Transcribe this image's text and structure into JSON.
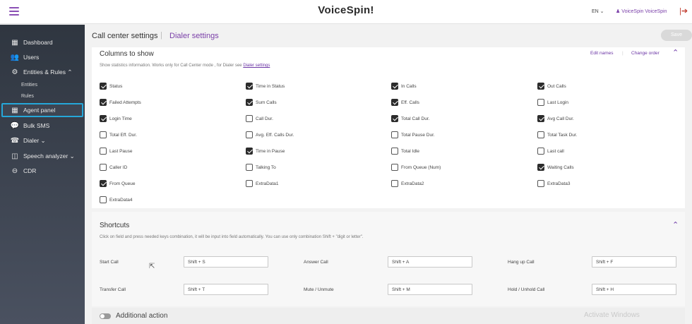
{
  "header": {
    "brand": "VoiceSpin!",
    "language": "EN ⌄",
    "user_name": "VoiceSpin VoiceSpin",
    "logout_glyph": "|➔",
    "menu_icon": "hamburger-icon"
  },
  "sidebar": {
    "items": [
      {
        "label": "Dashboard",
        "icon": "▦"
      },
      {
        "label": "Users",
        "icon": "👥"
      },
      {
        "label": "Entities & Rules ⌃",
        "icon": "⚙"
      },
      {
        "label": "Entities"
      },
      {
        "label": "Rules"
      },
      {
        "label": "Agent panel",
        "icon": "▦"
      },
      {
        "label": "Bulk SMS",
        "icon": "💬"
      },
      {
        "label": "Dialer ⌄",
        "icon": "☎"
      },
      {
        "label": "Speech analyzer ⌄",
        "icon": "◫"
      },
      {
        "label": "CDR",
        "icon": "⊖"
      }
    ]
  },
  "page": {
    "title": "Call center settings",
    "separator": "|",
    "dialer_link": "Dialer settings",
    "save_label": "Save"
  },
  "columns": {
    "title": "Columns to show",
    "desc": "Show statistics information. Works only for Call Center mode , for Dialer see",
    "desc_link": "Dialer settings",
    "edit_names": "Edit names",
    "separator": "|",
    "change_order": "Change order",
    "collapse_glyph": "⌃",
    "items": [
      {
        "label": "Status",
        "checked": true
      },
      {
        "label": "Time in Status",
        "checked": true
      },
      {
        "label": "In Calls",
        "checked": true
      },
      {
        "label": "Out Calls",
        "checked": true
      },
      {
        "label": "Failed Attempts",
        "checked": true
      },
      {
        "label": "Sum Calls",
        "checked": true
      },
      {
        "label": "Eff. Calls",
        "checked": true
      },
      {
        "label": "Last Login",
        "checked": false
      },
      {
        "label": "Login Time",
        "checked": true
      },
      {
        "label": "Call Dur.",
        "checked": false
      },
      {
        "label": "Total Call Dur.",
        "checked": true
      },
      {
        "label": "Avg Call Dur.",
        "checked": true
      },
      {
        "label": "Total Eff. Dur.",
        "checked": false
      },
      {
        "label": "Avg. Eff. Calls Dur.",
        "checked": false
      },
      {
        "label": "Total Pause Dur.",
        "checked": false
      },
      {
        "label": "Total Task Dur.",
        "checked": false
      },
      {
        "label": "Last Pause",
        "checked": false
      },
      {
        "label": "Time in Pause",
        "checked": true
      },
      {
        "label": "Total Idle",
        "checked": false
      },
      {
        "label": "Last call",
        "checked": false
      },
      {
        "label": "Caller ID",
        "checked": false
      },
      {
        "label": "Talking To",
        "checked": false
      },
      {
        "label": "From Queue (Num)",
        "checked": false
      },
      {
        "label": "Waiting Calls",
        "checked": true
      },
      {
        "label": "From Queue",
        "checked": true
      },
      {
        "label": "ExtraData1",
        "checked": false
      },
      {
        "label": "ExtraData2",
        "checked": false
      },
      {
        "label": "ExtraData3",
        "checked": false
      },
      {
        "label": "ExtraData4",
        "checked": false
      }
    ]
  },
  "shortcuts": {
    "title": "Shortcuts",
    "desc": "Click on field and press needed keys combination, it will be input into field automatically. You can use only combination Shift + \"digit or letter\".",
    "collapse_glyph": "⌃",
    "items": [
      {
        "label": "Start Call",
        "value": "Shift + S"
      },
      {
        "label": "Answer Call",
        "value": "Shift + A"
      },
      {
        "label": "Hang up Call",
        "value": "Shift + F"
      },
      {
        "label": "Transfer Call",
        "value": "Shift + T"
      },
      {
        "label": "Mute / Unmute",
        "value": "Shift + M"
      },
      {
        "label": "Hold / Unhold Call",
        "value": "Shift + H"
      }
    ]
  },
  "additional": {
    "label": "Additional action",
    "enabled": false
  },
  "watermark": "Activate Windows"
}
